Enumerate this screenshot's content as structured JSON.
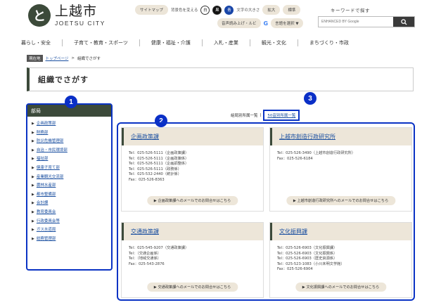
{
  "header": {
    "logo_mark": "と",
    "logo_jp": "上越市",
    "logo_en": "JOETSU CITY",
    "sitemap": "サイトマップ",
    "bg_label": "背景色を変える",
    "bg_white": "白",
    "bg_black": "黒",
    "bg_blue": "青",
    "text_size_label": "文字の大きさ",
    "enlarge": "拡大",
    "standard": "標準",
    "read_aloud": "音声読み上げ・ルビ",
    "google_g": "G",
    "language": "言語を選択 ▼",
    "search_label": "キーワードで探す",
    "search_placeholder": "ENHANCED BY Google"
  },
  "nav": {
    "items": [
      "暮らし・安全",
      "子育て・教育・スポーツ",
      "健康・福祉・介護",
      "入札・産業",
      "観光・文化",
      "まちづくり・市政"
    ]
  },
  "breadcrumb": {
    "tag": "現在地",
    "home": "トップページ",
    "separator": ">",
    "current": "組織でさがす"
  },
  "page_title": "組織でさがす",
  "sidebar": {
    "heading": "部局",
    "arrow": "▶",
    "items": [
      "企画政策部",
      "財務部",
      "防災危機管理部",
      "自治・市民環境部",
      "福祉部",
      "健康子育て部",
      "産業観光交流部",
      "農林水産部",
      "都市整備部",
      "会計課",
      "教育委員会",
      "行政委員会等",
      "ガス水道局",
      "総務管理部"
    ]
  },
  "badges": [
    "1",
    "2",
    "3"
  ],
  "list_links": {
    "bureau": "組局別所属一覧",
    "separator": "|",
    "kana": "50音別所属一覧"
  },
  "cards": [
    {
      "title": "企画政策課",
      "lines": [
        "Tel：025-526-5111（企画政策課）",
        "Tel：025-526-5111（企画政策係）",
        "Tel：025-526-5111（企画調整係）",
        "Tel：025-526-5111（政務係）",
        "Tel：025-532-2440（統計係）",
        "Fax：025-526-8363"
      ],
      "button": "▶ 企画政策課へのメールでのお問合せはこちら"
    },
    {
      "title": "上越市創造行政研究所",
      "lines": [
        "Tel：025-526-3490（上越市創造行政研究所）",
        "Fax：025-526-6184"
      ],
      "button": "▶ 上越市創造行政研究所へのメールでのお問合せはこちら"
    },
    {
      "title": "交通政策課",
      "lines": [
        "Tel：025-545-9207（交通政策課）",
        "Tel：（交通企画係）",
        "Tel：（地域交通係）",
        "Fax：025-543-2876"
      ],
      "button": "▶ 交通政策課へのメールでのお問合せはこちら"
    },
    {
      "title": "文化振興課",
      "lines": [
        "Tel：025-526-6903（文化振興課）",
        "Tel：025-526-6903（文化振興係）",
        "Tel：025-526-6903（歴史資源係）",
        "Tel：025-523-1083（小川未明文学館）",
        "Fax：025-526-6904"
      ],
      "button": "▶ 文化振興課へのメールでのお問合せはこちら"
    }
  ],
  "colors": {
    "accent": "#3c4a3a",
    "annotation_blue": "#0a33c4",
    "link": "#1a4fa0",
    "card_header_bg": "#ede6d9"
  }
}
